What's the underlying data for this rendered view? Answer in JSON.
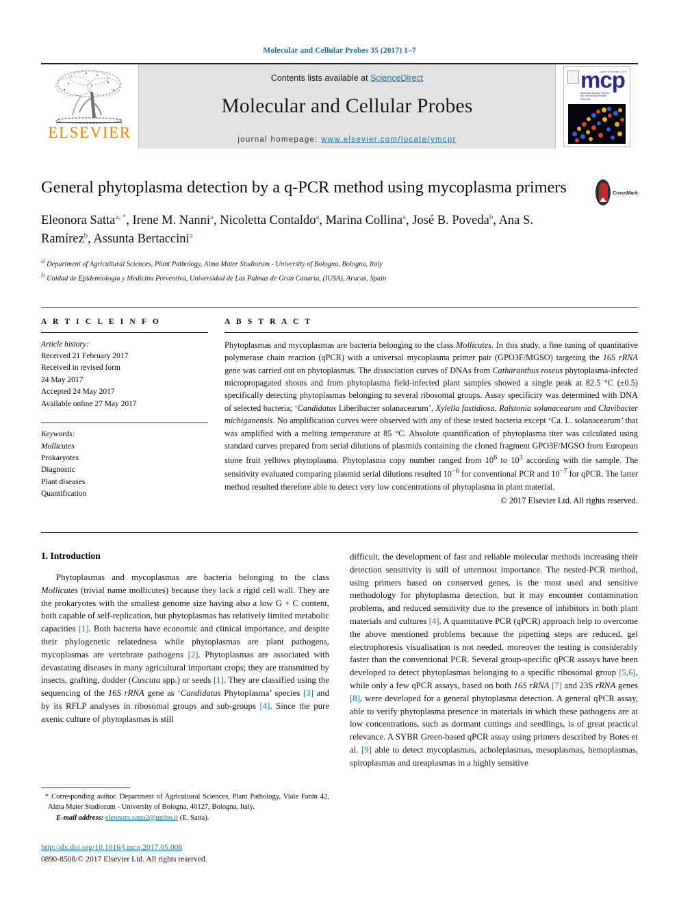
{
  "running_head": "Molecular and Cellular Probes 35 (2017) 1–7",
  "masthead": {
    "publisher_name": "ELSEVIER",
    "contents_prefix": "Contents lists available at ",
    "contents_link": "ScienceDirect",
    "journal_title": "Molecular and Cellular Probes",
    "homepage_prefix": "journal homepage: ",
    "homepage_url": "www.elsevier.com/locate/ymcpr",
    "cover": {
      "logo_text": "mcp",
      "subtitle": "Molecular Biology Tools for the Life and Biomedical Sciences",
      "issue_text": "Volume 35 Number 1 2017"
    }
  },
  "article": {
    "title": "General phytoplasma detection by a q-PCR method using mycoplasma primers",
    "crossmark_label": "CrossMark",
    "authors_line1": "Eleonora Satta",
    "authors": [
      {
        "name": "Eleonora Satta",
        "marks": "a, *"
      },
      {
        "name": "Irene M. Nanni",
        "marks": "a"
      },
      {
        "name": "Nicoletta Contaldo",
        "marks": "a"
      },
      {
        "name": "Marina Collina",
        "marks": "a"
      },
      {
        "name": "José B. Poveda",
        "marks": "b"
      },
      {
        "name": "Ana S. Ramírez",
        "marks": "b"
      },
      {
        "name": "Assunta Bertaccini",
        "marks": "a"
      }
    ],
    "affiliations": [
      {
        "mark": "a",
        "text": "Department of Agricultural Sciences, Plant Pathology, Alma Mater Studiorum - University of Bologna, Bologna, Italy"
      },
      {
        "mark": "b",
        "text": "Unidad de Epidemiologia y Medicina Preventiva, Universidad de Las Palmas de Gran Canaria, (IUSA), Arucas, Spain"
      }
    ]
  },
  "article_info": {
    "heading": "A R T I C L E   I N F O",
    "history_label": "Article history:",
    "history": [
      "Received 21 February 2017",
      "Received in revised form",
      "24 May 2017",
      "Accepted 24 May 2017",
      "Available online 27 May 2017"
    ],
    "keywords_label": "Keywords:",
    "keywords": [
      "Mollicutes",
      "Prokaryotes",
      "Diagnostic",
      "Plant diseases",
      "Quantification"
    ],
    "keywords_italic_index": 0
  },
  "abstract": {
    "heading": "A B S T R A C T",
    "copyright": "© 2017 Elsevier Ltd. All rights reserved."
  },
  "introduction": {
    "heading": "1. Introduction"
  },
  "footnotes": {
    "corresponding": "* Corresponding author. Department of Agricultural Sciences, Plant Pathology, Viale Fanin 42, Alma Mater Studiorum - University of Bologna, 40127, Bologna, Italy.",
    "email_label": "E-mail address:",
    "email": "eleonora.satta2@unibo.it",
    "email_suffix": "(E. Satta)."
  },
  "doi_block": {
    "doi": "http://dx.doi.org/10.1016/j.mcp.2017.05.008",
    "issn": "0890-8508/© 2017 Elsevier Ltd. All rights reserved."
  },
  "colors": {
    "link": "#1772a8",
    "elsevier_orange": "#ef8200",
    "masthead_band": "#e3e3e3",
    "crossmark_red": "#c1272d"
  }
}
